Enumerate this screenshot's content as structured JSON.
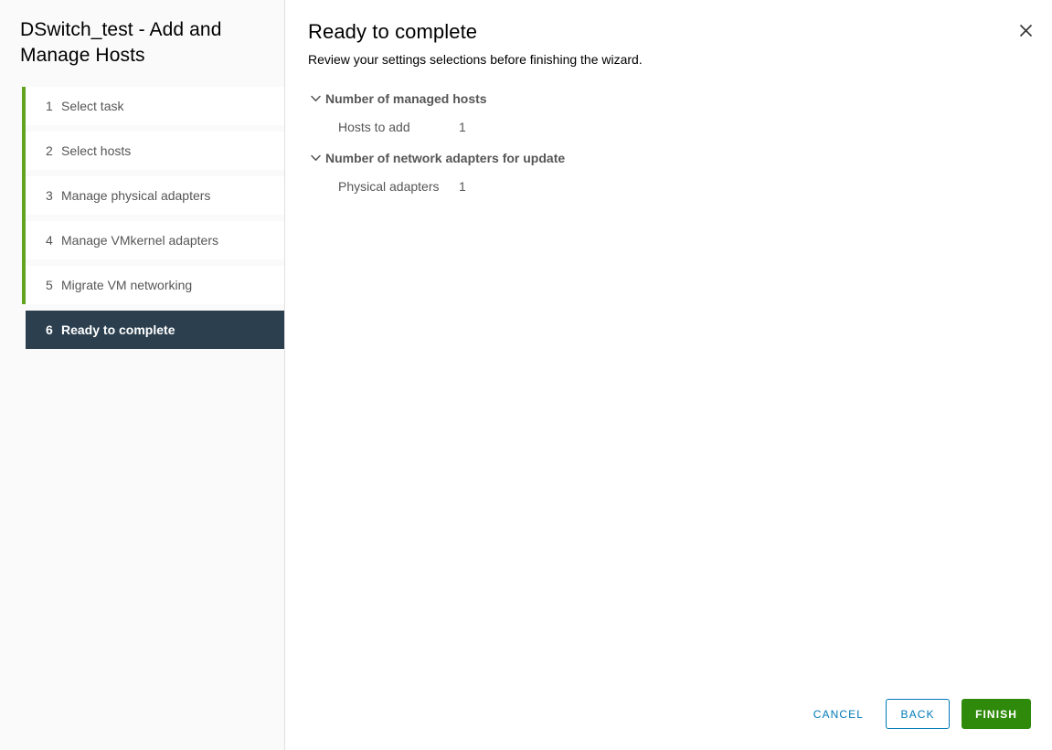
{
  "window": {
    "title": "DSwitch_test - Add and Manage Hosts",
    "close_icon": "close-icon"
  },
  "sidebar": {
    "steps": [
      {
        "number": "1",
        "label": "Select task",
        "active": false
      },
      {
        "number": "2",
        "label": "Select hosts",
        "active": false
      },
      {
        "number": "3",
        "label": "Manage physical adapters",
        "active": false
      },
      {
        "number": "4",
        "label": "Manage VMkernel adapters",
        "active": false
      },
      {
        "number": "5",
        "label": "Migrate VM networking",
        "active": false
      },
      {
        "number": "6",
        "label": "Ready to complete",
        "active": true
      }
    ],
    "accent_color": "#62a420",
    "active_bg": "#2b3f4e"
  },
  "main": {
    "title": "Ready to complete",
    "subtitle": "Review your settings selections before finishing the wizard.",
    "groups": [
      {
        "header": "Number of managed hosts",
        "chevron_icon": "chevron-down-icon",
        "rows": [
          {
            "label": "Hosts to add",
            "value": "1"
          }
        ]
      },
      {
        "header": "Number of network adapters for update",
        "chevron_icon": "chevron-down-icon",
        "rows": [
          {
            "label": "Physical adapters",
            "value": "1"
          }
        ]
      }
    ]
  },
  "footer": {
    "cancel_label": "CANCEL",
    "back_label": "BACK",
    "finish_label": "FINISH",
    "link_color": "#0079b8",
    "finish_color": "#2f8a0b"
  }
}
